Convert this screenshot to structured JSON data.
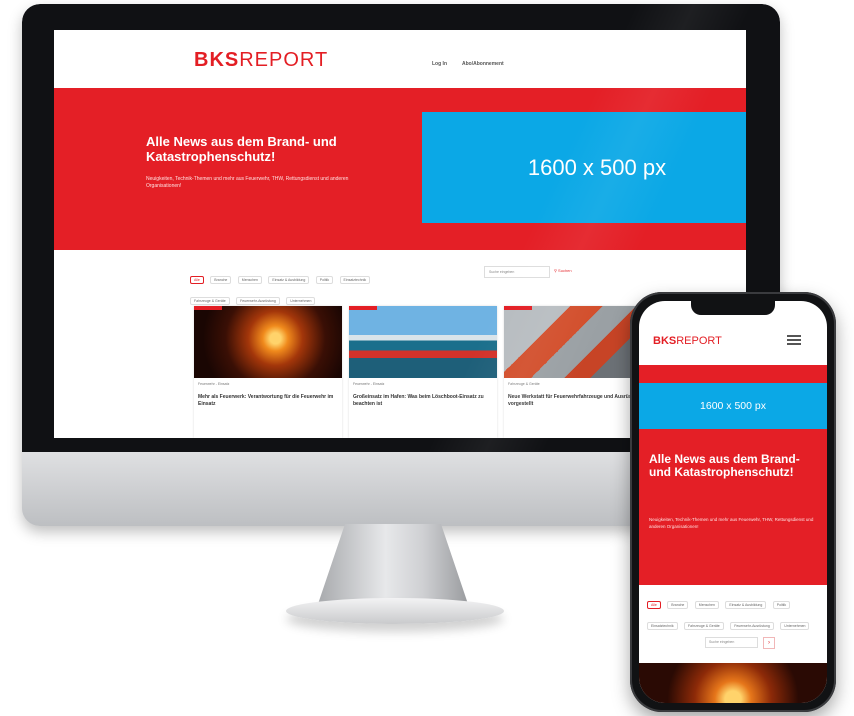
{
  "desktop": {
    "logo": {
      "bold": "BKS",
      "light": "REPORT"
    },
    "nav": {
      "login": "Log In",
      "subscribe": "Abo/Abonnement"
    },
    "hero": {
      "title": "Alle News aus dem Brand- und Katastrophenschutz!",
      "text": "Neuigkeiten, Technik-Themen und mehr aus Feuerwehr, THW, Rettungsdienst und anderen Organisationen!",
      "placeholder": "1600 x 500 px"
    },
    "filters": [
      "Alle",
      "Branche",
      "Menschen",
      "Einsatz & Ausbildung",
      "Politik",
      "Einsatztechnik",
      "Fahrzeuge & Geräte",
      "Feuerwehr-Ausrüstung",
      "Unternehmen"
    ],
    "search": {
      "placeholder": "Suche eingeben",
      "button": "Suchen"
    },
    "cards": [
      {
        "meta": "Feuerwehr - Einsatz",
        "title": "Mehr als Feuerwerk: Verantwortung für die Feuerwehr im Einsatz"
      },
      {
        "meta": "Feuerwehr - Einsatz",
        "title": "Großeinsatz im Hafen: Was beim Löschboot-Einsatz zu beachten ist"
      },
      {
        "meta": "Fahrzeuge & Geräte",
        "title": "Neue Werkstatt für Feuerwehrfahrzeuge und Ausrüstung vorgestellt"
      }
    ]
  },
  "mobile": {
    "logo": {
      "bold": "BKS",
      "light": "REPORT"
    },
    "hero": {
      "placeholder": "1600 x 500 px",
      "title": "Alle News aus dem Brand- und Katastrophenschutz!",
      "text": "Neuigkeiten, Technik-Themen und mehr aus Feuerwehr, THW, Rettungsdienst und anderen Organisationen!"
    },
    "filters": [
      "Alle",
      "Branche",
      "Menschen",
      "Einsatz & Ausbildung",
      "Politik",
      "Einsatztechnik",
      "Fahrzeuge & Geräte",
      "Feuerwehr-Ausrüstung",
      "Unternehmen"
    ],
    "search": {
      "placeholder": "Suche eingeben",
      "button": "›"
    }
  },
  "colors": {
    "brand_red": "#e31e24",
    "placeholder_blue": "#0ba8e6"
  }
}
